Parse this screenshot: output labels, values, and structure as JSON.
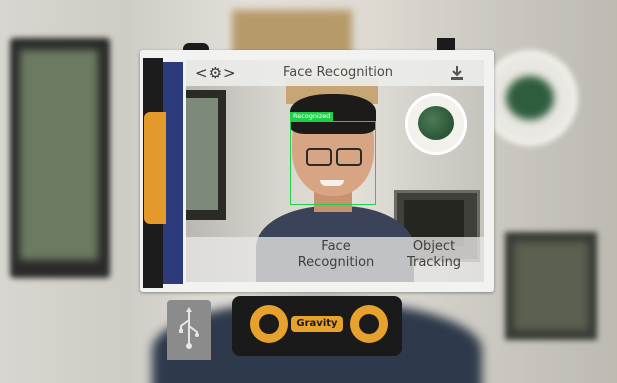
{
  "app": {
    "title": "Face Recognition"
  },
  "toolbar": {
    "back_glyph": "<",
    "settings_glyph": "⚙",
    "forward_glyph": ">"
  },
  "detection": {
    "label": "Recognized",
    "box_color": "#21d04a"
  },
  "modes": [
    {
      "line1": "Face",
      "line2": "Recognition"
    },
    {
      "line1": "Object",
      "line2": "Tracking"
    }
  ],
  "board": {
    "brand": "Gravity"
  },
  "icons": {
    "back": "chevron-left-icon",
    "settings": "gear-icon",
    "forward": "chevron-right-icon",
    "download": "download-icon",
    "usb": "usb-icon"
  },
  "colors": {
    "accent_orange": "#e49a2b",
    "side_blue": "#2b3b7c",
    "detection_green": "#21d04a"
  }
}
